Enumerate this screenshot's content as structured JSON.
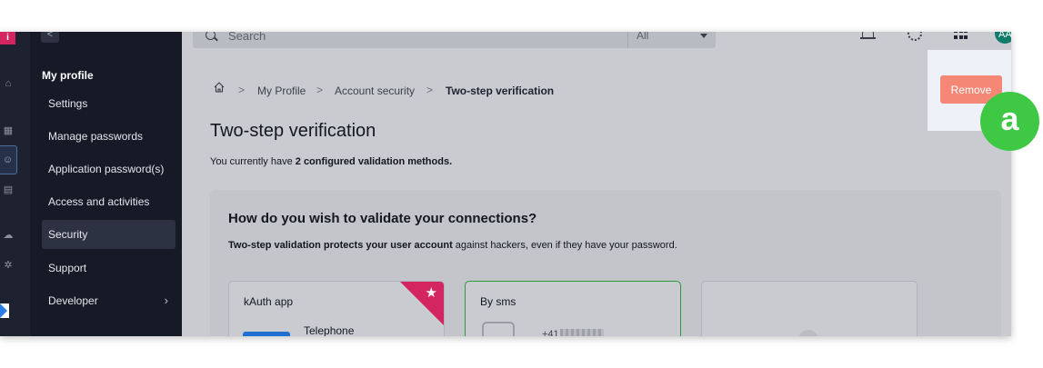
{
  "app": {
    "logo_glyph": "i",
    "avatar_initials": "AA"
  },
  "search": {
    "placeholder": "Search",
    "filter_value": "All"
  },
  "sidebar": {
    "collapse_glyph": "<",
    "section_title": "My profile",
    "items": [
      {
        "label": "Settings"
      },
      {
        "label": "Manage passwords"
      },
      {
        "label": "Application password(s)"
      },
      {
        "label": "Access and activities"
      },
      {
        "label": "Security"
      },
      {
        "label": "Support"
      },
      {
        "label": "Developer"
      }
    ],
    "active_item": "Security"
  },
  "breadcrumb": {
    "items": [
      "My Profile",
      "Account security",
      "Two-step verification"
    ],
    "separator": ">"
  },
  "page": {
    "title": "Two-step verification",
    "subtitle_prefix": "You currently have ",
    "subtitle_bold": "2 configured validation methods."
  },
  "card": {
    "heading": "How do you wish to validate your connections?",
    "text_bold": "Two-step validation protects your user account",
    "text_rest": " against hackers, even if they have your password."
  },
  "options": [
    {
      "title": "kAuth app",
      "subtitle": "Telephone"
    },
    {
      "title": "By sms",
      "subtitle": "+41"
    },
    {
      "title": "",
      "subtitle": ""
    }
  ],
  "actions": {
    "remove_label": "Remove"
  },
  "annotation": {
    "label": "a"
  },
  "colors": {
    "accent_pink": "#d3255f",
    "remove": "#f48776",
    "badge": "#3ec844",
    "selected_border": "#2e9b3f"
  }
}
